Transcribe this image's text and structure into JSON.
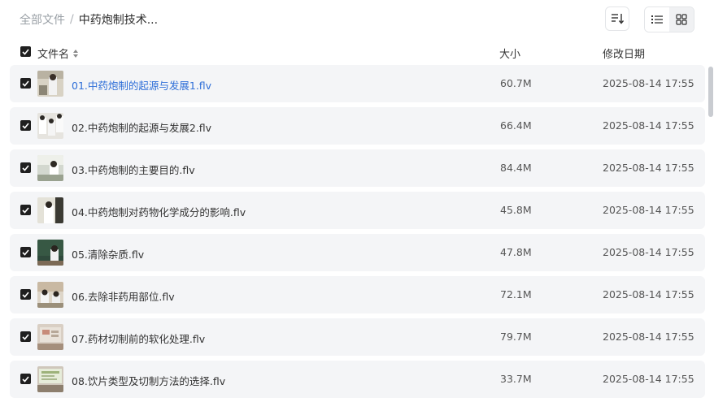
{
  "breadcrumb": {
    "root": "全部文件",
    "separator": "/",
    "current": "中药炮制技术..."
  },
  "toolbar": {
    "sort_icon": "sort-icon",
    "list_view_icon": "list-view-icon",
    "grid_view_icon": "grid-view-icon"
  },
  "table": {
    "headers": {
      "name": "文件名",
      "size": "大小",
      "date": "修改日期"
    },
    "rows": [
      {
        "name": "01.中药炮制的起源与发展1.flv",
        "size": "60.7M",
        "date": "2025-08-14 17:55"
      },
      {
        "name": "02.中药炮制的起源与发展2.flv",
        "size": "66.4M",
        "date": "2025-08-14 17:55"
      },
      {
        "name": "03.中药炮制的主要目的.flv",
        "size": "84.4M",
        "date": "2025-08-14 17:55"
      },
      {
        "name": "04.中药炮制对药物化学成分的影响.flv",
        "size": "45.8M",
        "date": "2025-08-14 17:55"
      },
      {
        "name": "05.清除杂质.flv",
        "size": "47.8M",
        "date": "2025-08-14 17:55"
      },
      {
        "name": "06.去除非药用部位.flv",
        "size": "72.1M",
        "date": "2025-08-14 17:55"
      },
      {
        "name": "07.药材切制前的软化处理.flv",
        "size": "79.7M",
        "date": "2025-08-14 17:55"
      },
      {
        "name": "08.饮片类型及切制方法的选择.flv",
        "size": "33.7M",
        "date": "2025-08-14 17:55"
      }
    ]
  },
  "colors": {
    "link": "#2f6fd8",
    "row_bg": "#f4f5f7",
    "checkbox": "#1f1f1f"
  }
}
